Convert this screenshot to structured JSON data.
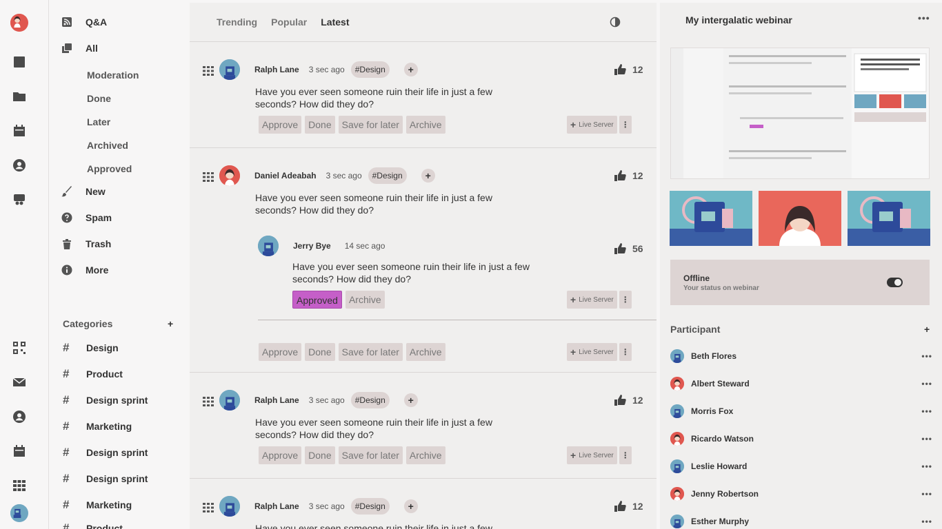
{
  "nav": {
    "items": [
      {
        "label": "Q&A",
        "icon": "rss-icon"
      },
      {
        "label": "All",
        "icon": "copy-icon"
      },
      {
        "label": "New",
        "icon": "brush-icon"
      },
      {
        "label": "Spam",
        "icon": "question-icon"
      },
      {
        "label": "Trash",
        "icon": "trash-icon"
      },
      {
        "label": "More",
        "icon": "info-icon"
      }
    ],
    "sub_items": [
      "Moderation",
      "Done",
      "Later",
      "Archived",
      "Approved"
    ],
    "categories_title": "Categories",
    "categories_add": "+",
    "categories": [
      "Design",
      "Product",
      "Design sprint",
      "Marketing",
      "Design sprint",
      "Design sprint",
      "Marketing",
      "Product"
    ]
  },
  "main": {
    "tabs": [
      "Trending",
      "Popular",
      "Latest"
    ],
    "active_tab": "Latest",
    "posts": [
      {
        "user": "Ralph Lane",
        "time": "3 sec ago",
        "tag": "#Design",
        "likes": "12",
        "text": "Have you ever seen someone ruin their life in just a few seconds? How did they do?",
        "avatar": "blue"
      },
      {
        "user": "Daniel Adeabah",
        "time": "3 sec ago",
        "tag": "#Design",
        "likes": "12",
        "text": "Have you ever seen someone ruin their life in just a few seconds? How did they do?",
        "avatar": "red"
      },
      {
        "user": "Ralph Lane",
        "time": "3 sec ago",
        "tag": "#Design",
        "likes": "12",
        "text": "Have you ever seen someone ruin their life in just a few seconds? How did they do?",
        "avatar": "blue"
      },
      {
        "user": "Ralph Lane",
        "time": "3 sec ago",
        "tag": "#Design",
        "likes": "12",
        "text": "Have you ever seen someone ruin their life in just a few",
        "avatar": "blue"
      }
    ],
    "reply": {
      "user": "Jerry Bye",
      "time": "14 sec ago",
      "likes": "56",
      "text": "Have you ever seen someone ruin their life in just a few seconds? How did they do?",
      "approved_label": "Approved",
      "archive_label": "Archive"
    },
    "actions": {
      "approve": "Approve",
      "done": "Done",
      "save": "Save for later",
      "archive": "Archive"
    },
    "live_server": "Live Server",
    "plus": "+"
  },
  "right": {
    "title": "My intergalatic webinar",
    "more": "•••",
    "status_title": "Offline",
    "status_sub": "Your status on webinar",
    "status_on": false,
    "participant_title": "Participant",
    "participant_add": "+",
    "participants": [
      {
        "name": "Beth Flores",
        "avatar": "blue"
      },
      {
        "name": "Albert Steward",
        "avatar": "red"
      },
      {
        "name": "Morris Fox",
        "avatar": "blue"
      },
      {
        "name": "Ricardo Watson",
        "avatar": "red"
      },
      {
        "name": "Leslie Howard",
        "avatar": "blue"
      },
      {
        "name": "Jenny Robertson",
        "avatar": "red"
      },
      {
        "name": "Esther Murphy",
        "avatar": "blue"
      }
    ]
  },
  "colors": {
    "accent_approved": "#c55fc8",
    "panel": "#f0efee",
    "chip": "#ddd4d3",
    "avatar_red": "#e0574f",
    "avatar_blue": "#6fa7c1"
  }
}
